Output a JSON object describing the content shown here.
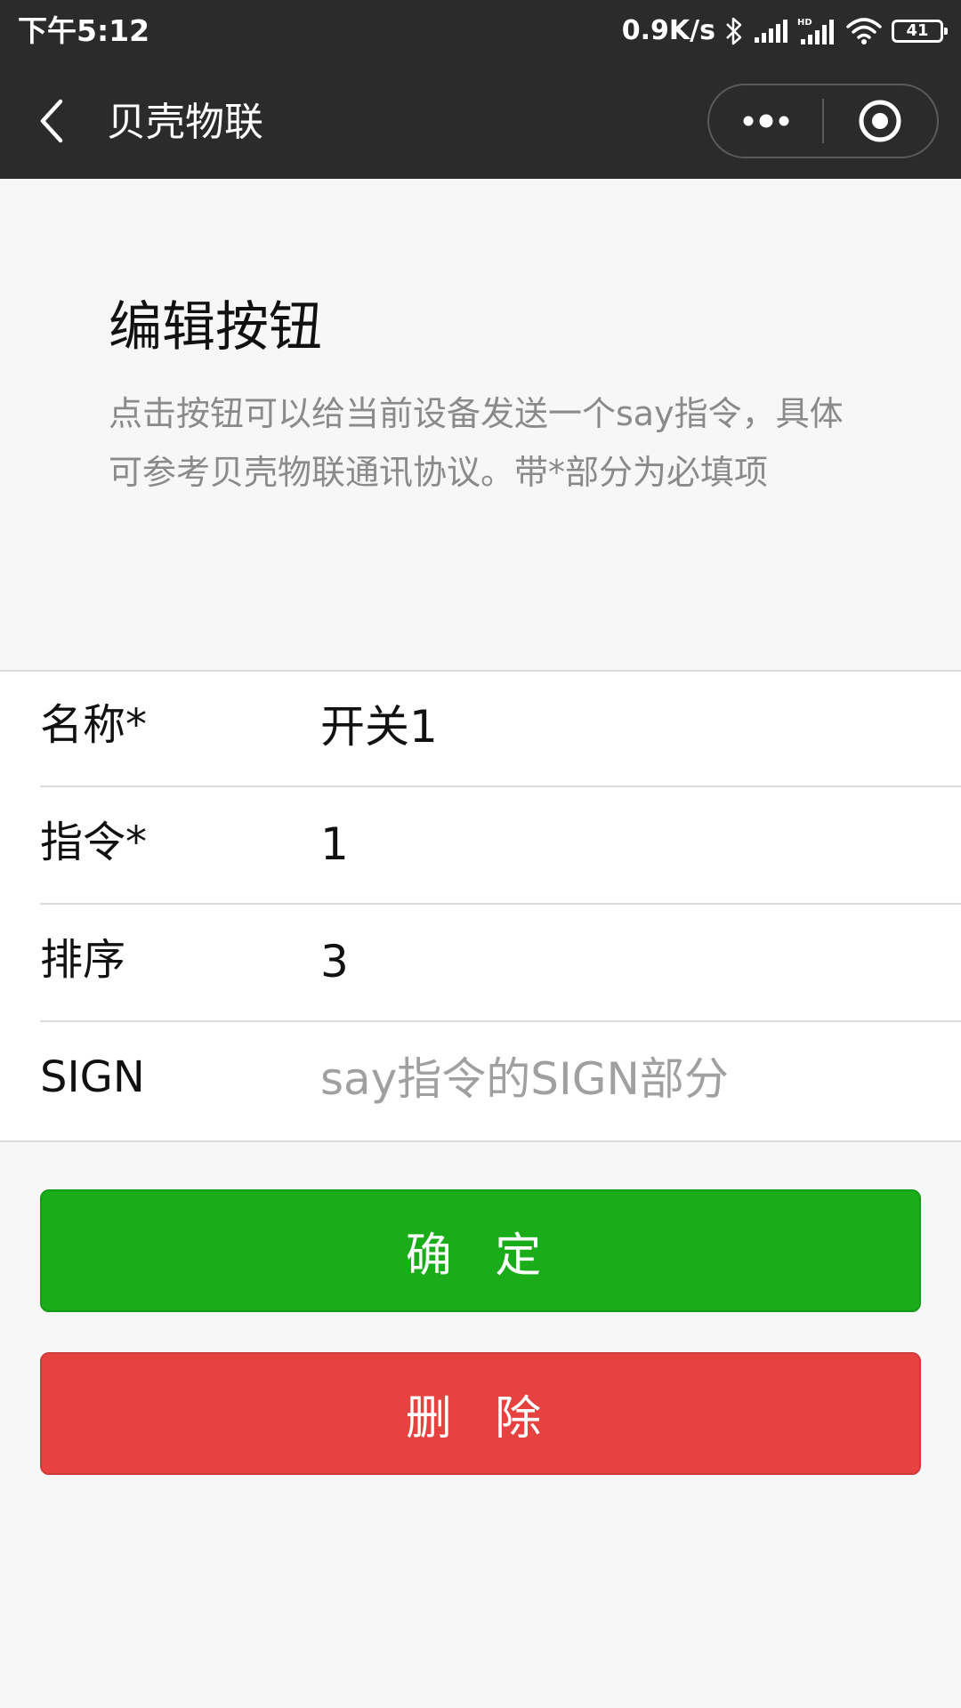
{
  "status_bar": {
    "time": "下午5:12",
    "net_speed": "0.9K/s",
    "battery_level": "41",
    "icons": [
      "bluetooth-icon",
      "signal-icon",
      "hd-signal-icon",
      "wifi-icon",
      "battery-icon"
    ]
  },
  "nav": {
    "title": "贝壳物联",
    "back_icon": "chevron-left-icon",
    "more_icon": "more-dots-icon",
    "close_icon": "target-close-icon"
  },
  "header": {
    "title": "编辑按钮",
    "description": "点击按钮可以给当前设备发送一个say指令，具体可参考贝壳物联通讯协议。带*部分为必填项"
  },
  "form": {
    "rows": [
      {
        "label": "名称*",
        "value": "开关1",
        "placeholder": ""
      },
      {
        "label": "指令*",
        "value": "1",
        "placeholder": ""
      },
      {
        "label": "排序",
        "value": "3",
        "placeholder": ""
      },
      {
        "label": "SIGN",
        "value": "",
        "placeholder": "say指令的SIGN部分"
      }
    ]
  },
  "buttons": {
    "confirm_label": "确 定",
    "delete_label": "删 除"
  },
  "colors": {
    "nav_bg": "#2b2b2b",
    "page_bg": "#f7f7f7",
    "confirm": "#1aad19",
    "delete": "#e64340"
  }
}
